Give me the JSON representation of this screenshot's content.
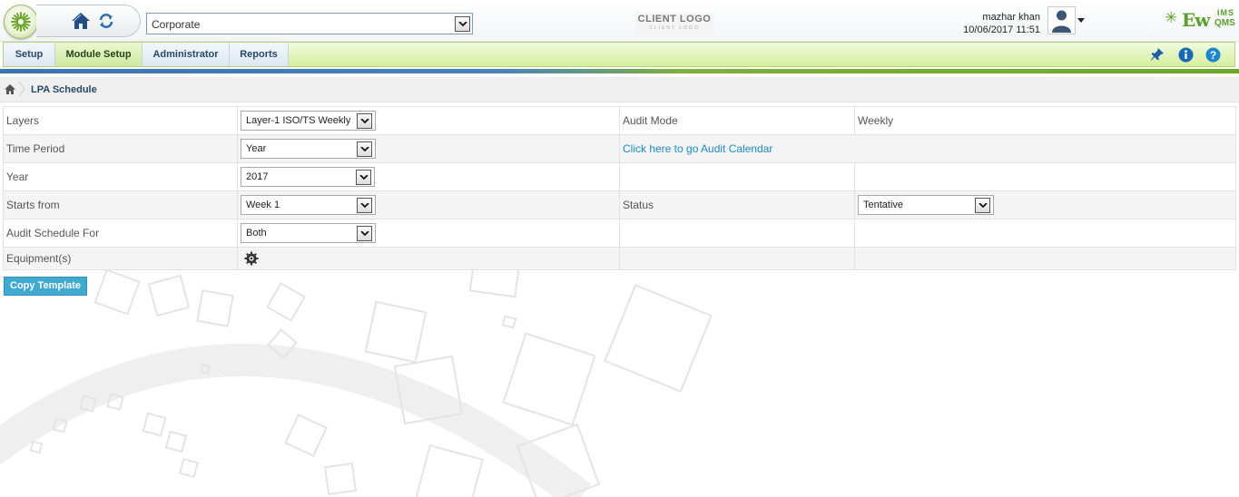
{
  "header": {
    "organization": "Corporate",
    "client_logo_text": "CLIENT LOGO",
    "client_logo_subtext": "CLIENT LOGO",
    "user_name": "mazhar khan",
    "datetime": "10/06/2017 11:51",
    "brand_ims": "IMS",
    "brand_ew": "Ew",
    "brand_qms": "QMS"
  },
  "nav": {
    "items": [
      {
        "label": "Setup"
      },
      {
        "label": "Module Setup"
      },
      {
        "label": "Administrator"
      },
      {
        "label": "Reports"
      }
    ],
    "active": "Module Setup"
  },
  "breadcrumb": {
    "title": "LPA Schedule"
  },
  "form": {
    "layers_label": "Layers",
    "layers_value": "Layer-1 ISO/TS Weekly a",
    "audit_mode_label": "Audit Mode",
    "audit_mode_value": "Weekly",
    "time_period_label": "Time Period",
    "time_period_value": "Year",
    "audit_calendar_link": "Click here to go Audit Calendar",
    "year_label": "Year",
    "year_value": "2017",
    "starts_from_label": "Starts from",
    "starts_from_value": "Week 1",
    "status_label": "Status",
    "status_value": "Tentative",
    "audit_schedule_for_label": "Audit Schedule For",
    "audit_schedule_for_value": "Both",
    "equipment_label": "Equipment(s)"
  },
  "copy_template_label": "Copy Template",
  "colors": {
    "accent_blue": "#3fa9cf",
    "nav_green": "#d5ef9b",
    "link_blue": "#1a8ac7",
    "brand_green": "#58a028"
  }
}
